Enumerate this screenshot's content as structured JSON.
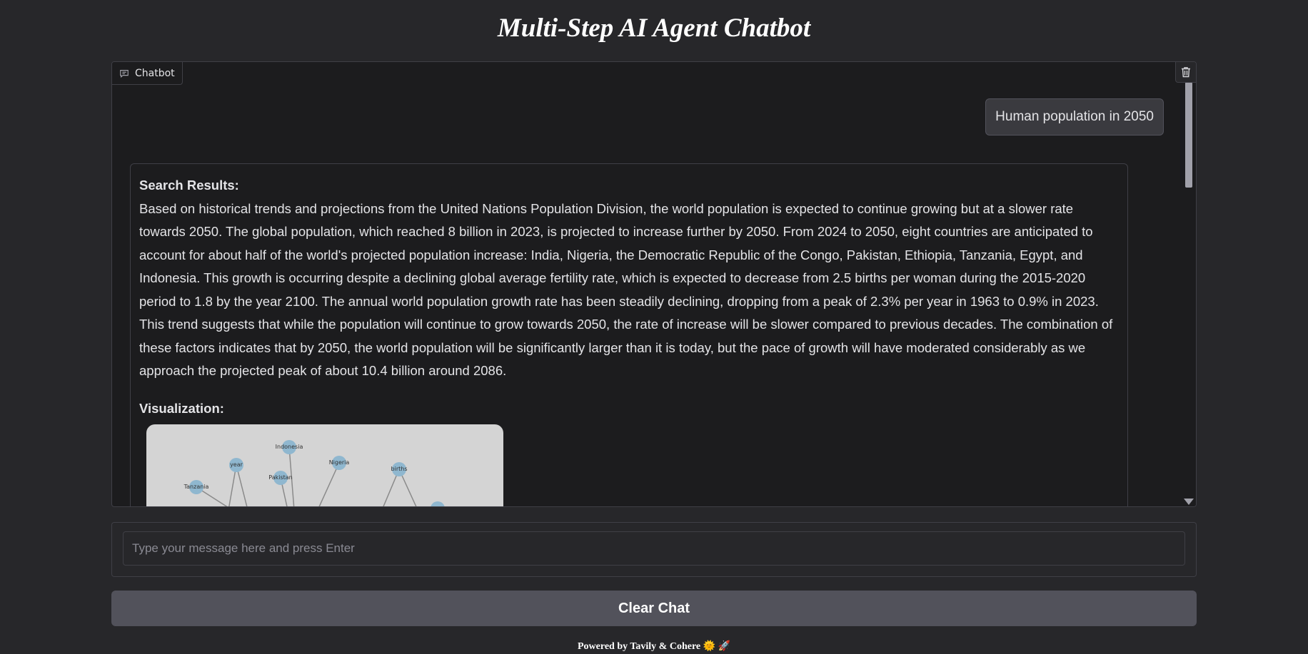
{
  "app": {
    "title": "Multi-Step AI Agent Chatbot"
  },
  "chatbot": {
    "label": "Chatbot"
  },
  "messages": {
    "user": "Human population in 2050",
    "bot": {
      "search_heading": "Search Results:",
      "search_text": "Based on historical trends and projections from the United Nations Population Division, the world population is expected to continue growing but at a slower rate towards 2050. The global population, which reached 8 billion in 2023, is projected to increase further by 2050. From 2024 to 2050, eight countries are anticipated to account for about half of the world's projected population increase: India, Nigeria, the Democratic Republic of the Congo, Pakistan, Ethiopia, Tanzania, Egypt, and Indonesia. This growth is occurring despite a declining global average fertility rate, which is expected to decrease from 2.5 births per woman during the 2015-2020 period to 1.8 by the year 2100. The annual world population growth rate has been steadily declining, dropping from a peak of 2.3% per year in 1963 to 0.9% in 2023. This trend suggests that while the population will continue to grow towards 2050, the rate of increase will be slower compared to previous decades. The combination of these factors indicates that by 2050, the world population will be significantly larger than it is today, but the pace of growth will have moderated considerably as we approach the projected peak of about 10.4 billion around 2086.",
      "viz_heading": "Visualization:",
      "graph_nodes": [
        "Indonesia",
        "year",
        "Nigeria",
        "Pakistan",
        "births",
        "Tanzania"
      ]
    }
  },
  "input": {
    "placeholder": "Type your message here and press Enter"
  },
  "buttons": {
    "clear": "Clear Chat"
  },
  "footer": {
    "text": "Powered by Tavily & Cohere 🌞 🚀"
  },
  "icons": {
    "chat": "chat-bubble-icon",
    "trash": "trash-icon",
    "scroll_down": "chevron-down-icon"
  }
}
